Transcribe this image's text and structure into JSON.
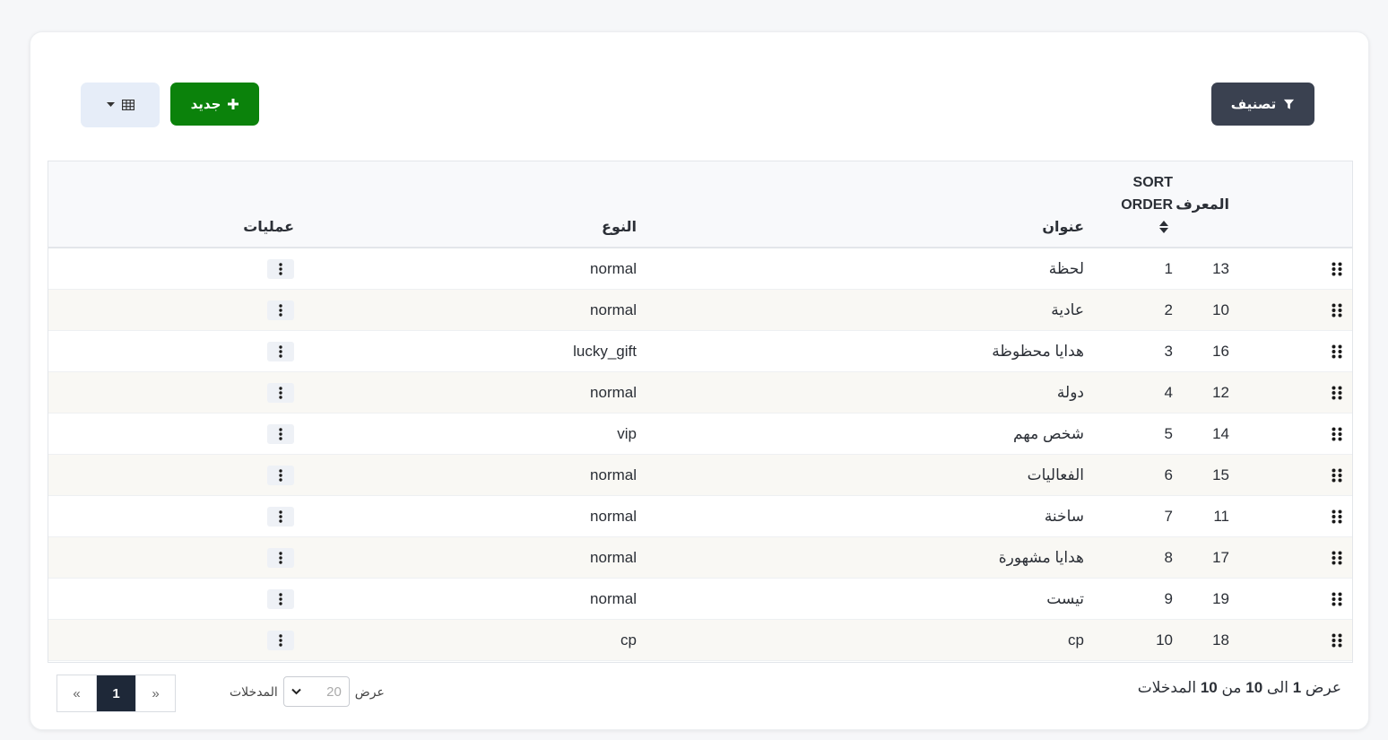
{
  "toolbar": {
    "filter_label": "تصنيف",
    "new_label": "جديد"
  },
  "table": {
    "headers": {
      "id": "المعرف",
      "sort_order": "SORT ORDER",
      "title": "عنوان",
      "type": "النوع",
      "operations": "عمليات"
    },
    "rows": [
      {
        "id": "13",
        "sort": "1",
        "title": "لحظة",
        "type": "normal"
      },
      {
        "id": "10",
        "sort": "2",
        "title": "عادية",
        "type": "normal"
      },
      {
        "id": "16",
        "sort": "3",
        "title": "هدايا محظوظة",
        "type": "lucky_gift"
      },
      {
        "id": "12",
        "sort": "4",
        "title": "دولة",
        "type": "normal"
      },
      {
        "id": "14",
        "sort": "5",
        "title": "شخص مهم",
        "type": "vip"
      },
      {
        "id": "15",
        "sort": "6",
        "title": "الفعاليات",
        "type": "normal"
      },
      {
        "id": "11",
        "sort": "7",
        "title": "ساخنة",
        "type": "normal"
      },
      {
        "id": "17",
        "sort": "8",
        "title": "هدايا مشهورة",
        "type": "normal"
      },
      {
        "id": "19",
        "sort": "9",
        "title": "تيست",
        "type": "normal"
      },
      {
        "id": "18",
        "sort": "10",
        "title": "cp",
        "type": "cp"
      }
    ]
  },
  "footer": {
    "summary_prefix": "عرض",
    "summary_from": "1",
    "summary_to_word": "الى",
    "summary_to": "10",
    "summary_of_word": "من",
    "summary_total": "10",
    "summary_suffix": "المدخلات",
    "show_label": "عرض",
    "page_size": "20",
    "entries_label": "المدخلات",
    "pager": {
      "prev": "«",
      "current": "1",
      "next": "»"
    }
  },
  "colors": {
    "filter_button": "#3a4150",
    "new_button": "#0b820b",
    "active_page": "#1e2838"
  }
}
